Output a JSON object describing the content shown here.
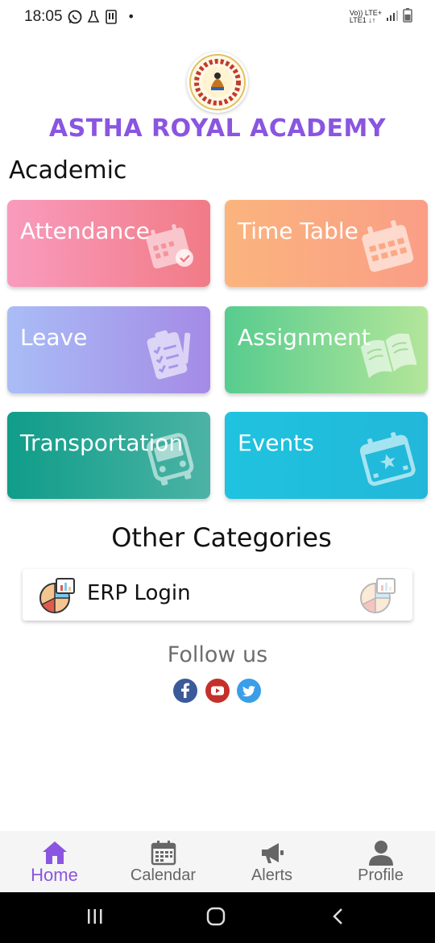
{
  "status_bar": {
    "time": "18:05",
    "network_top": "Vo)) LTE+",
    "network_bottom": "LTE1 ↓↑",
    "dot": "•"
  },
  "header": {
    "title": "ASTHA ROYAL ACADEMY",
    "title_color": "#8a55e0"
  },
  "academic": {
    "heading": "Academic",
    "tiles": [
      {
        "label": "Attendance",
        "icon": "calendar-check-icon"
      },
      {
        "label": "Time Table",
        "icon": "calendar-grid-icon"
      },
      {
        "label": "Leave",
        "icon": "clipboard-pencil-icon"
      },
      {
        "label": "Assignment",
        "icon": "open-book-icon"
      },
      {
        "label": "Transportation",
        "icon": "bus-icon"
      },
      {
        "label": "Events",
        "icon": "calendar-star-icon"
      }
    ]
  },
  "other": {
    "heading": "Other Categories",
    "erp_label": "ERP Login",
    "erp_icon": "chart-report-icon"
  },
  "follow": {
    "heading": "Follow us",
    "links": [
      "facebook-icon",
      "youtube-icon",
      "twitter-icon"
    ]
  },
  "bottom_nav": {
    "items": [
      {
        "label": "Home",
        "icon": "home-icon",
        "active": true
      },
      {
        "label": "Calendar",
        "icon": "calendar-icon",
        "active": false
      },
      {
        "label": "Alerts",
        "icon": "megaphone-icon",
        "active": false
      },
      {
        "label": "Profile",
        "icon": "person-icon",
        "active": false
      }
    ]
  }
}
